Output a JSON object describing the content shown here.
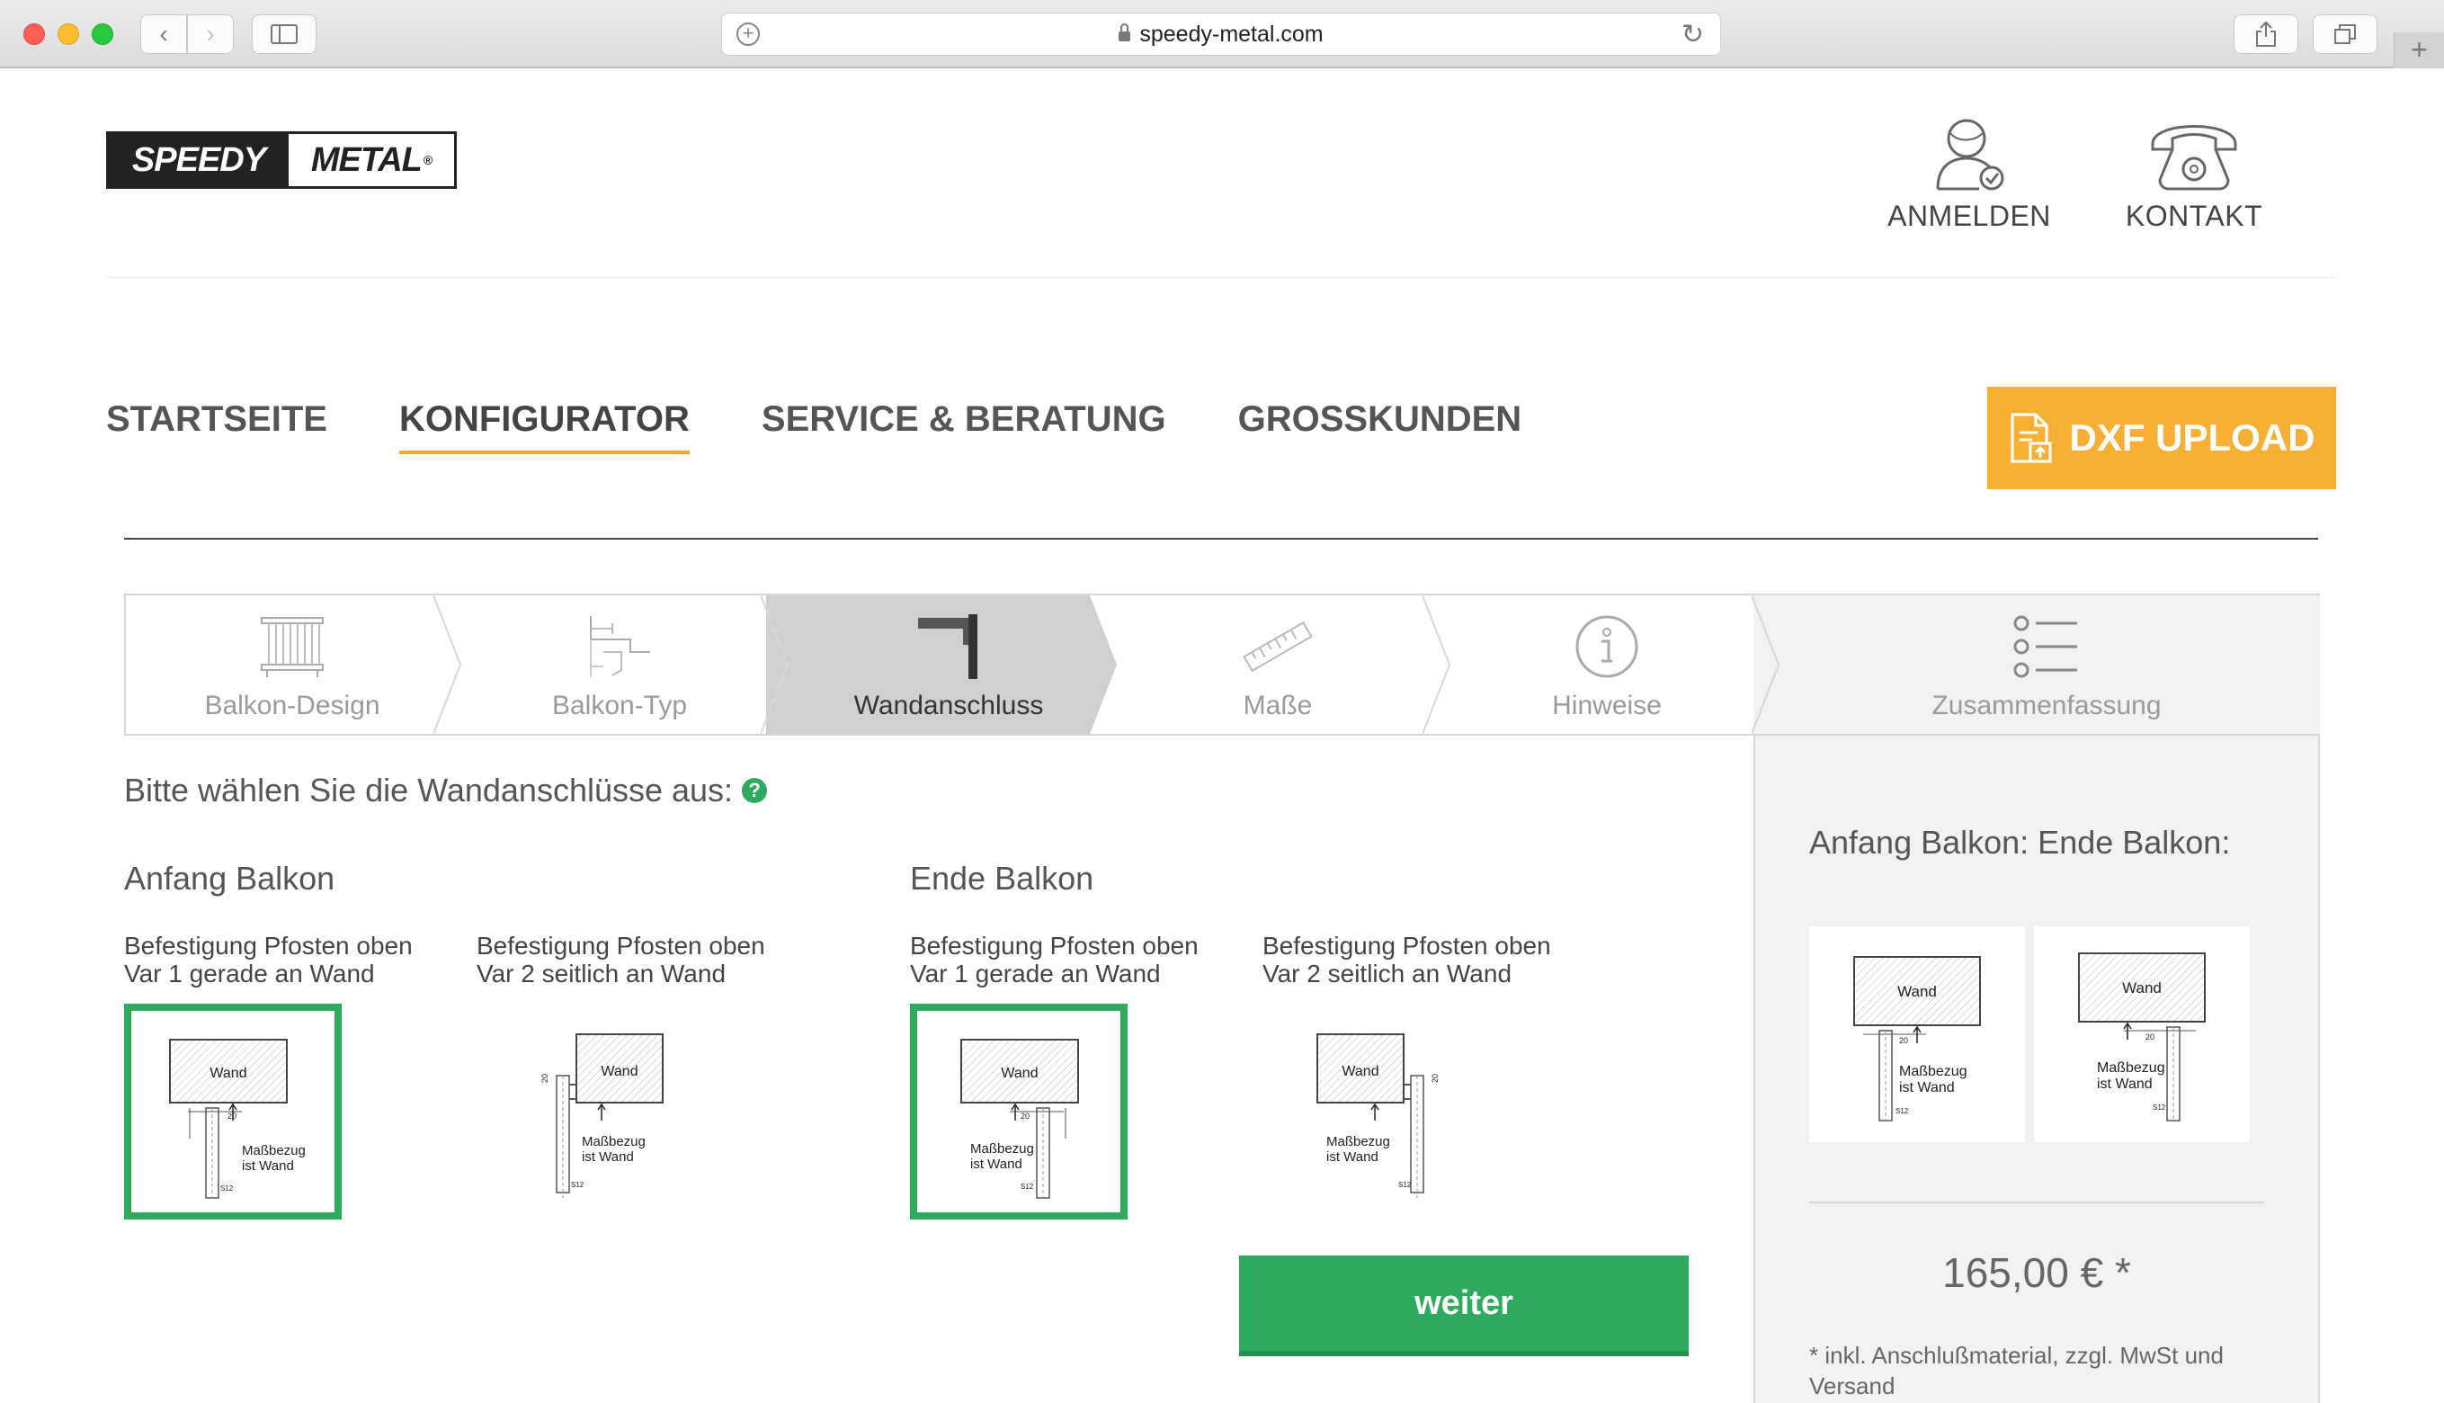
{
  "browser": {
    "url": "speedy-metal.com"
  },
  "header": {
    "logo_left": "SPEEDY",
    "logo_right": "METAL",
    "logo_mark": "®",
    "login_label": "ANMELDEN",
    "contact_label": "KONTAKT"
  },
  "nav": {
    "items": [
      "STARTSEITE",
      "KONFIGURATOR",
      "SERVICE & BERATUNG",
      "GROSSKUNDEN"
    ],
    "active": "KONFIGURATOR",
    "dxf_label": "DXF UPLOAD"
  },
  "steps": [
    {
      "label": "Balkon-Design",
      "icon": "railing-icon"
    },
    {
      "label": "Balkon-Typ",
      "icon": "balcony-type-icon"
    },
    {
      "label": "Wandanschluss",
      "icon": "wall-mount-icon",
      "active": true
    },
    {
      "label": "Maße",
      "icon": "ruler-icon"
    },
    {
      "label": "Hinweise",
      "icon": "info-icon"
    },
    {
      "label": "Zusammenfassung",
      "icon": "list-icon"
    }
  ],
  "content": {
    "question": "Bitte wählen Sie die Wandanschlüsse aus:",
    "help": "?",
    "start_title": "Anfang Balkon",
    "end_title": "Ende Balkon",
    "options": [
      {
        "line1": "Befestigung Pfosten oben",
        "line2": "Var 1 gerade an Wand"
      },
      {
        "line1": "Befestigung Pfosten oben",
        "line2": "Var 2 seitlich an Wand"
      },
      {
        "line1": "Befestigung Pfosten oben",
        "line2": "Var 1 gerade an Wand"
      },
      {
        "line1": "Befestigung Pfosten oben",
        "line2": "Var 2 seitlich an Wand"
      }
    ],
    "drawing": {
      "wall": "Wand",
      "ref1": "Maßbezug",
      "ref2": "ist Wand",
      "dim_a": "20",
      "dim_b": "S12"
    },
    "next_label": "weiter"
  },
  "summary": {
    "title": "Anfang Balkon: Ende Balkon:",
    "price": "165,00 € *",
    "note": "* inkl. Anschlußmaterial, zzgl. MwSt und Versand"
  },
  "colors": {
    "accent_orange": "#f8b034",
    "accent_green": "#2eaa5e"
  }
}
